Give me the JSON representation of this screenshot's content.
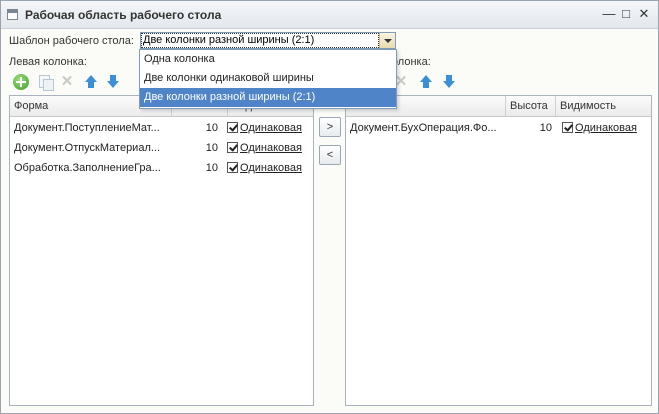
{
  "window": {
    "title": "Рабочая область рабочего стола",
    "minimize_glyph": "—",
    "maximize_glyph": "□",
    "close_glyph": "✕"
  },
  "template": {
    "label": "Шаблон рабочего стола:",
    "selected": "Две колонки разной ширины (2:1)",
    "options": [
      "Одна колонка",
      "Две колонки одинаковой ширины",
      "Две колонки разной ширины (2:1)"
    ]
  },
  "left_column": {
    "label": "Левая колонка:",
    "columns": [
      "Форма",
      "",
      "Видимость"
    ],
    "rows": [
      {
        "form": "Документ.ПоступлениеМат...",
        "height": "10",
        "visibility": "Одинаковая"
      },
      {
        "form": "Документ.ОтпускМатериал...",
        "height": "10",
        "visibility": "Одинаковая"
      },
      {
        "form": "Обработка.ЗаполнениеГра...",
        "height": "10",
        "visibility": "Одинаковая"
      }
    ]
  },
  "right_column": {
    "label_visible": "колонка:",
    "columns": [
      "",
      "Высота",
      "Видимость"
    ],
    "rows": [
      {
        "form": "Документ.БухОперация.Фо...",
        "height": "10",
        "visibility": "Одинаковая"
      }
    ]
  },
  "move_buttons": {
    "right": ">",
    "left": "<"
  },
  "icons": [
    "add-icon",
    "copy-icon",
    "delete-icon",
    "move-up-icon",
    "move-down-icon"
  ]
}
